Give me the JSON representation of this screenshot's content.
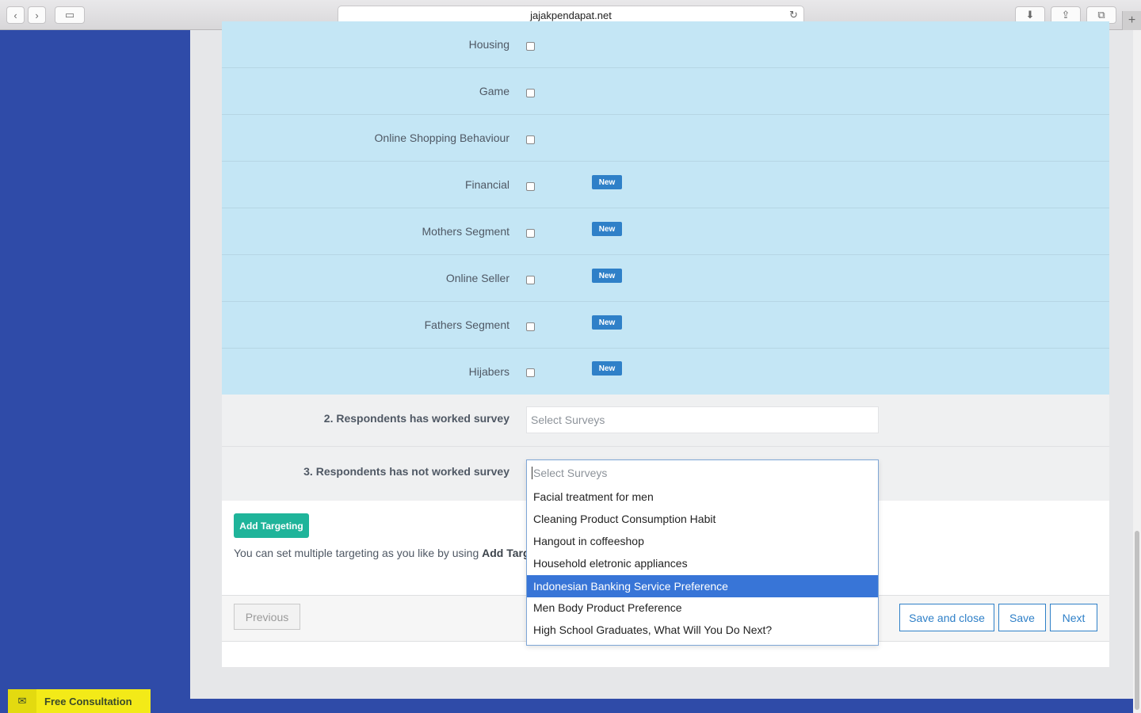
{
  "browser": {
    "url": "jajakpendapat.net",
    "back_glyph": "‹",
    "forward_glyph": "›",
    "sidebar_glyph": "▭",
    "reload_glyph": "↻",
    "download_glyph": "⬇",
    "share_glyph": "⇪",
    "tabs_glyph": "⧉",
    "new_tab_glyph": "+"
  },
  "categories": [
    {
      "label": "Housing",
      "badge": ""
    },
    {
      "label": "Game",
      "badge": ""
    },
    {
      "label": "Online Shopping Behaviour",
      "badge": ""
    },
    {
      "label": "Financial",
      "badge": "New"
    },
    {
      "label": "Mothers Segment",
      "badge": "New"
    },
    {
      "label": "Online Seller",
      "badge": "New"
    },
    {
      "label": "Fathers Segment",
      "badge": "New"
    },
    {
      "label": "Hijabers",
      "badge": "New"
    }
  ],
  "worked_survey": {
    "label": "2. Respondents has worked survey",
    "placeholder": "Select Surveys"
  },
  "not_worked_survey": {
    "label": "3. Respondents has not worked survey",
    "placeholder": "Select Surveys",
    "options": [
      "Facial treatment for men",
      "Cleaning Product Consumption Habit",
      "Hangout in coffeeshop",
      "Household eletronic appliances",
      "Indonesian Banking Service Preference",
      "Men Body Product Preference",
      "High School Graduates, What Will You Do Next?"
    ],
    "highlighted_index": 4
  },
  "targeting": {
    "add_button": "Add Targeting",
    "help_prefix": "You can set multiple targeting as you like by using ",
    "help_bold": "Add Targe"
  },
  "navigation": {
    "previous": "Previous",
    "save_and_close": "Save and close",
    "save": "Save",
    "next": "Next"
  },
  "consultation": {
    "label": "Free Consultation",
    "icon_glyph": "✉"
  },
  "colors": {
    "sidebar": "#2f4ba8",
    "category_row": "#c4e6f5",
    "badge": "#2f80c8",
    "add_button": "#1fb49a",
    "highlight": "#3875d7",
    "consult": "#f3ea18"
  }
}
